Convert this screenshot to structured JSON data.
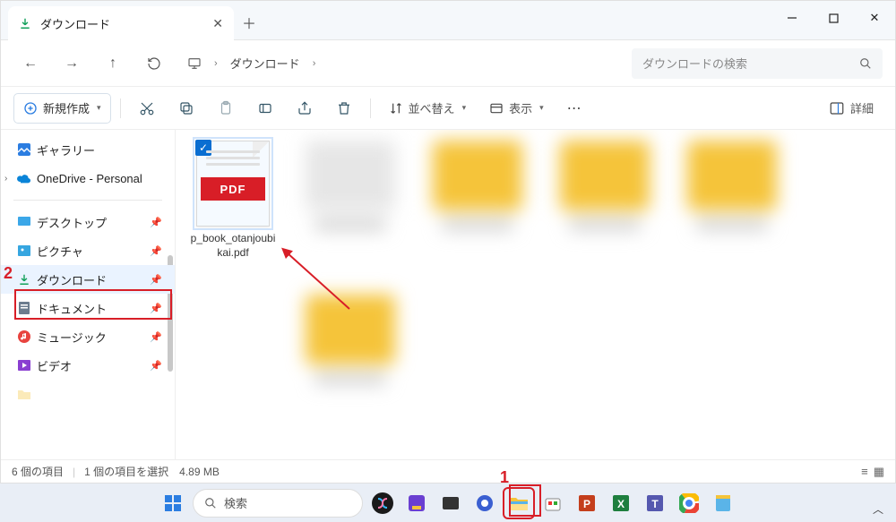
{
  "tab": {
    "title": "ダウンロード"
  },
  "address": {
    "crumb1": "ダウンロード"
  },
  "search": {
    "placeholder": "ダウンロードの検索"
  },
  "toolbar": {
    "new": "新規作成",
    "sort": "並べ替え",
    "view": "表示",
    "details": "詳細"
  },
  "sidebar": {
    "gallery": "ギャラリー",
    "onedrive": "OneDrive - Personal",
    "desktop": "デスクトップ",
    "pictures": "ピクチャ",
    "downloads": "ダウンロード",
    "documents": "ドキュメント",
    "music": "ミュージック",
    "video": "ビデオ"
  },
  "file": {
    "name": "p_book_otanjoubikai.pdf",
    "badge": "PDF"
  },
  "status": {
    "count": "6 個の項目",
    "selected": "1 個の項目を選択",
    "size": "4.89 MB"
  },
  "taskbar": {
    "search": "検索"
  },
  "annotations": {
    "one": "1",
    "two": "2"
  }
}
